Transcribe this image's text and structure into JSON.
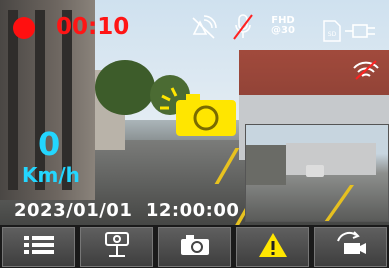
{
  "recording": {
    "time": "00:10",
    "color": "#ff1515"
  },
  "status": {
    "resolution_line1": "FHD",
    "resolution_line2": "@30"
  },
  "speed": {
    "value": "0",
    "unit": "Km/h",
    "color": "#23d6ff"
  },
  "timestamp": "2023/01/01  12:00:00",
  "icons": [
    "gps-off-icon",
    "mic-muted-icon",
    "resolution-icon",
    "sd-card-icon",
    "power-plug-icon",
    "wifi-icon",
    "capture-camera-icon"
  ],
  "toolbar": {
    "buttons": [
      "menu-icon",
      "parking-monitor-icon",
      "camera-icon",
      "warning-icon",
      "switch-camera-icon"
    ],
    "warning_color": "#ffe600"
  }
}
